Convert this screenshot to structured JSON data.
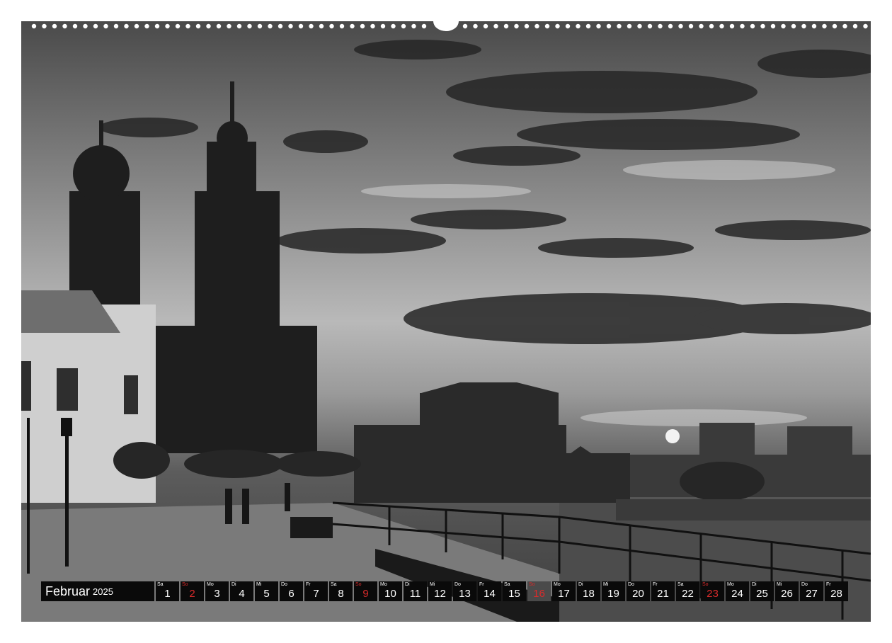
{
  "calendar": {
    "month": "Februar",
    "year": "2025",
    "days": [
      {
        "weekday": "Sa",
        "day": "1",
        "sunday": false,
        "highlight": false
      },
      {
        "weekday": "So",
        "day": "2",
        "sunday": true,
        "highlight": false
      },
      {
        "weekday": "Mo",
        "day": "3",
        "sunday": false,
        "highlight": false
      },
      {
        "weekday": "Di",
        "day": "4",
        "sunday": false,
        "highlight": false
      },
      {
        "weekday": "Mi",
        "day": "5",
        "sunday": false,
        "highlight": false
      },
      {
        "weekday": "Do",
        "day": "6",
        "sunday": false,
        "highlight": false
      },
      {
        "weekday": "Fr",
        "day": "7",
        "sunday": false,
        "highlight": false
      },
      {
        "weekday": "Sa",
        "day": "8",
        "sunday": false,
        "highlight": false
      },
      {
        "weekday": "So",
        "day": "9",
        "sunday": true,
        "highlight": false
      },
      {
        "weekday": "Mo",
        "day": "10",
        "sunday": false,
        "highlight": false
      },
      {
        "weekday": "Di",
        "day": "11",
        "sunday": false,
        "highlight": false
      },
      {
        "weekday": "Mi",
        "day": "12",
        "sunday": false,
        "highlight": false
      },
      {
        "weekday": "Do",
        "day": "13",
        "sunday": false,
        "highlight": false
      },
      {
        "weekday": "Fr",
        "day": "14",
        "sunday": false,
        "highlight": false
      },
      {
        "weekday": "Sa",
        "day": "15",
        "sunday": false,
        "highlight": false
      },
      {
        "weekday": "So",
        "day": "16",
        "sunday": true,
        "highlight": true
      },
      {
        "weekday": "Mo",
        "day": "17",
        "sunday": false,
        "highlight": false
      },
      {
        "weekday": "Di",
        "day": "18",
        "sunday": false,
        "highlight": false
      },
      {
        "weekday": "Mi",
        "day": "19",
        "sunday": false,
        "highlight": false
      },
      {
        "weekday": "Do",
        "day": "20",
        "sunday": false,
        "highlight": false
      },
      {
        "weekday": "Fr",
        "day": "21",
        "sunday": false,
        "highlight": false
      },
      {
        "weekday": "Sa",
        "day": "22",
        "sunday": false,
        "highlight": false
      },
      {
        "weekday": "So",
        "day": "23",
        "sunday": true,
        "highlight": false
      },
      {
        "weekday": "Mo",
        "day": "24",
        "sunday": false,
        "highlight": false
      },
      {
        "weekday": "Di",
        "day": "25",
        "sunday": false,
        "highlight": false
      },
      {
        "weekday": "Mi",
        "day": "26",
        "sunday": false,
        "highlight": false
      },
      {
        "weekday": "Do",
        "day": "27",
        "sunday": false,
        "highlight": false
      },
      {
        "weekday": "Fr",
        "day": "28",
        "sunday": false,
        "highlight": false
      }
    ]
  },
  "colors": {
    "cell_background": "#0a0a0a",
    "sunday_text": "#d92b2b",
    "highlight_background": "#4a4a4a",
    "text": "#ffffff"
  },
  "photo": {
    "style": "black-and-white",
    "icon": "cityscape-photo"
  }
}
